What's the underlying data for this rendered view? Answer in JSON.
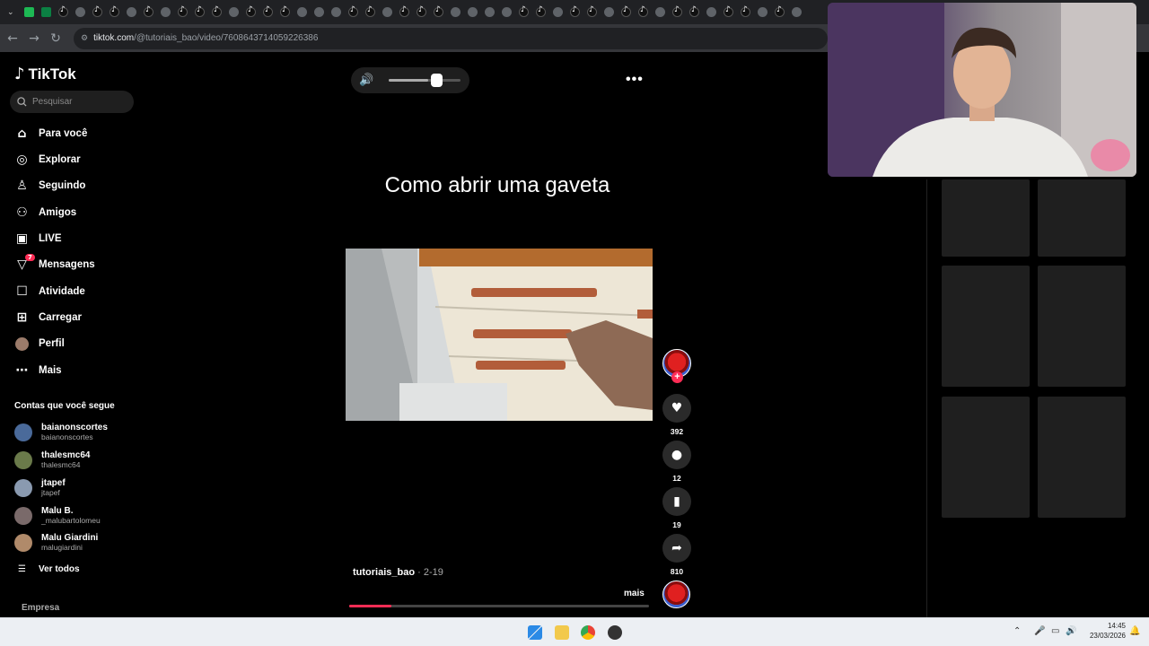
{
  "browser": {
    "url_host": "tiktok.com",
    "url_path": "/@tutoriais_bao/video/7608643714059226386",
    "nav_icons": [
      "chevron-down-icon",
      "back-icon",
      "forward-icon",
      "reload-icon",
      "site-info-icon"
    ]
  },
  "sidebar": {
    "logo_text": "TikTok",
    "search_placeholder": "Pesquisar",
    "items": [
      {
        "label": "Para você",
        "icon": "home-icon"
      },
      {
        "label": "Explorar",
        "icon": "compass-icon"
      },
      {
        "label": "Seguindo",
        "icon": "following-icon"
      },
      {
        "label": "Amigos",
        "icon": "friends-icon"
      },
      {
        "label": "LIVE",
        "icon": "live-icon"
      },
      {
        "label": "Mensagens",
        "icon": "messages-icon",
        "badge": "7"
      },
      {
        "label": "Atividade",
        "icon": "activity-icon"
      },
      {
        "label": "Carregar",
        "icon": "upload-icon"
      },
      {
        "label": "Perfil",
        "icon": "profile-avatar"
      },
      {
        "label": "Mais",
        "icon": "more-icon"
      }
    ],
    "following_title": "Contas que você segue",
    "following": [
      {
        "name": "baianonscortes",
        "handle": "baianonscortes"
      },
      {
        "name": "thalesmc64",
        "handle": "thalesmc64"
      },
      {
        "name": "jtapef",
        "handle": "jtapef"
      },
      {
        "name": "Malu B.",
        "handle": "_malubartolomeu"
      },
      {
        "name": "Malu Giardini",
        "handle": "malugiardini"
      }
    ],
    "see_all": "Ver todos",
    "footer": "Empresa"
  },
  "video": {
    "caption": "Como abrir uma gaveta",
    "author": "tutoriais_bao",
    "date": "· 2-19",
    "more_label": "mais",
    "volume_fraction": 0.55,
    "progress_fraction": 0.14
  },
  "actions": {
    "likes": "392",
    "comments": "12",
    "saves": "19",
    "shares": "810"
  },
  "taskbar": {
    "time": "14:45",
    "date": "23/03/2026"
  },
  "colors": {
    "accent": "#fe2c55",
    "background": "#000000",
    "panel": "#1f1f1f"
  }
}
